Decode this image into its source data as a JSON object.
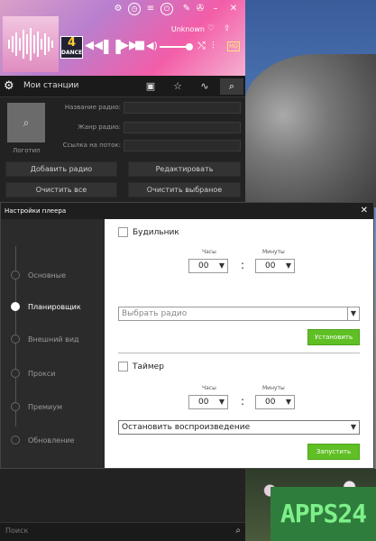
{
  "player": {
    "artist": "Unknown",
    "tab_title": "Мои станции",
    "album_badge_num": "4",
    "album_badge_text": "DANCE",
    "quality_badge": "MQ",
    "logo_label": "Логотип",
    "fields": {
      "radio_name_label": "Название радио:",
      "genre_label": "Жанр радио:",
      "stream_label": "Ссылка на поток:"
    },
    "buttons": {
      "add": "Добавить радио",
      "edit": "Редактировать",
      "clear_all": "Очистить все",
      "clear_selected": "Очистить выбраное"
    },
    "search_placeholder": "Поиск"
  },
  "dialog": {
    "title": "Настройки плеера",
    "nav": [
      "Основные",
      "Планировщик",
      "Внешний вид",
      "Прокси",
      "Премиум",
      "Обновление"
    ],
    "active_nav": 1,
    "alarm": {
      "label": "Будильник",
      "hours_label": "Часы",
      "minutes_label": "Минуты",
      "hours": "00",
      "minutes": "00",
      "radio_placeholder": "Выбрать радио",
      "button": "Установить"
    },
    "timer": {
      "label": "Таймер",
      "hours_label": "Часы",
      "minutes_label": "Минуты",
      "hours": "00",
      "minutes": "00",
      "action": "Остановить воспроизведение",
      "button": "Запустить"
    }
  },
  "watermark": "APPS24",
  "colors": {
    "accent_green": "#5fbf25",
    "player_pink": "#f35da8"
  }
}
